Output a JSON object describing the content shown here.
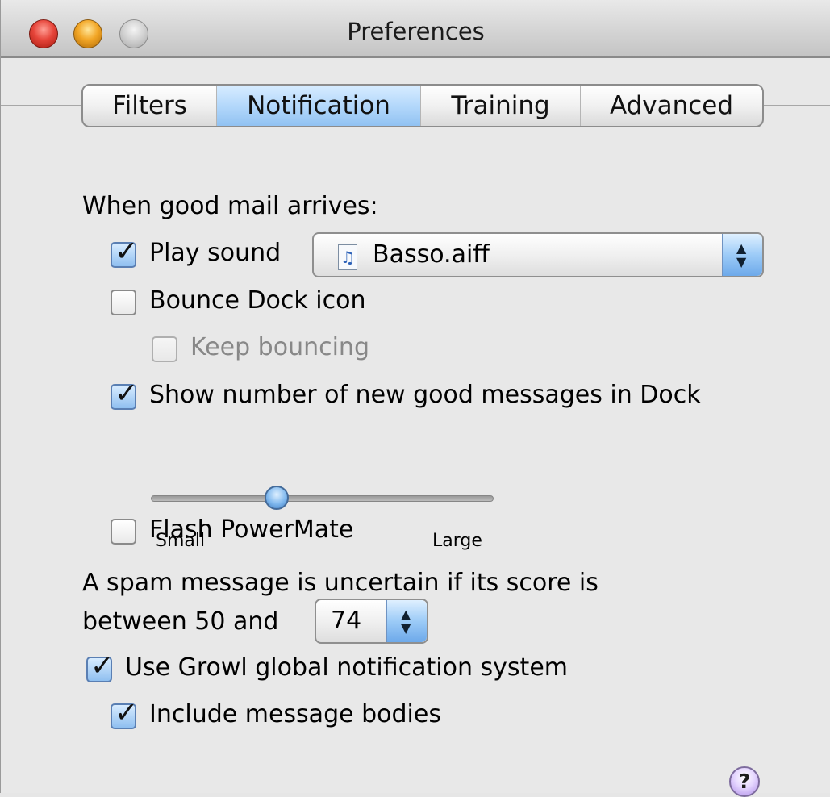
{
  "window": {
    "title": "Preferences"
  },
  "tabs": [
    {
      "label": "Filters"
    },
    {
      "label": "Notification"
    },
    {
      "label": "Training"
    },
    {
      "label": "Advanced"
    }
  ],
  "notification": {
    "when_good_mail_label": "When good mail arrives:",
    "play_sound": {
      "label": "Play sound",
      "checked": true
    },
    "sound_select": {
      "value": "Basso.aiff",
      "icon": "music-file-icon"
    },
    "bounce_dock": {
      "label": "Bounce Dock icon",
      "checked": false
    },
    "keep_bouncing": {
      "label": "Keep bouncing",
      "checked": false,
      "enabled": false
    },
    "show_number": {
      "label": "Show number of new good messages in Dock",
      "checked": true
    },
    "size_slider": {
      "min_label": "Small",
      "max_label": "Large",
      "level": 0.37
    },
    "flash_powermate": {
      "label": "Flash PowerMate",
      "checked": false
    },
    "spam_text_line1": "A spam message is uncertain if its score is",
    "spam_text_line2": "between 50 and",
    "spam_score_select": {
      "value": "74"
    },
    "use_growl": {
      "label": "Use Growl global notification system",
      "checked": true
    },
    "include_bodies": {
      "label": "Include message bodies",
      "checked": true
    }
  },
  "help": {
    "label": "?"
  },
  "icons": {
    "close": "close-window-icon",
    "minimize": "minimize-window-icon",
    "zoom": "zoom-window-icon",
    "music": "music-file-icon",
    "help": "help-icon"
  }
}
